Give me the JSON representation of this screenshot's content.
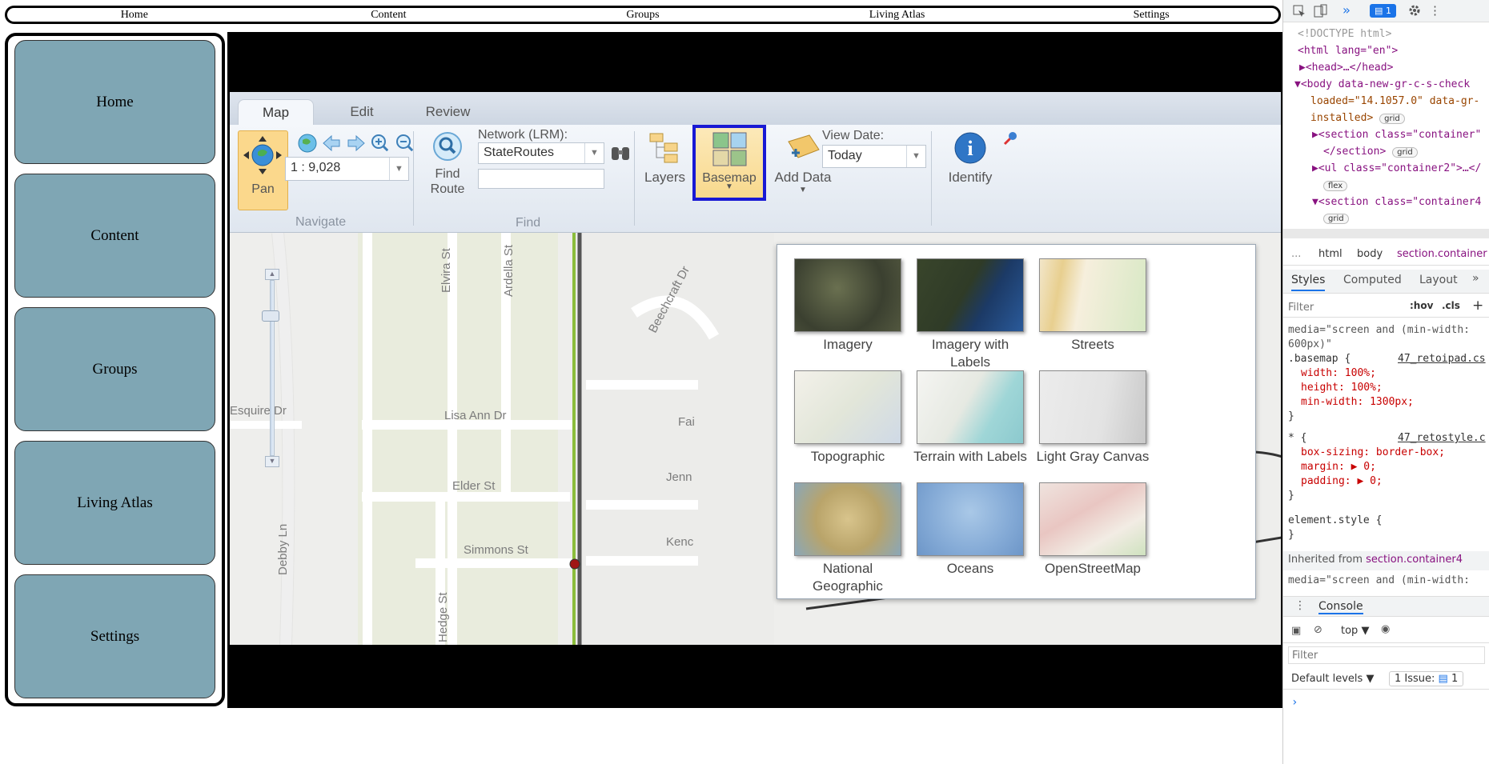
{
  "topnav": {
    "items": [
      "Home",
      "Content",
      "Groups",
      "Living Atlas",
      "Settings"
    ]
  },
  "sidebar": {
    "items": [
      "Home",
      "Content",
      "Groups",
      "Living Atlas",
      "Settings"
    ]
  },
  "app": {
    "tabs": [
      "Map",
      "Edit",
      "Review"
    ],
    "pan_label": "Pan",
    "scale_value": "1 : 9,028",
    "navigate_label": "Navigate",
    "find_route_label": "Find\nRoute",
    "network_label": "Network (LRM):",
    "network_value": "StateRoutes",
    "find_label": "Find",
    "layers_label": "Layers",
    "basemap_label": "Basemap",
    "add_data_label": "Add Data",
    "view_date_label": "View Date:",
    "view_date_value": "Today",
    "identify_label": "Identify",
    "streets": [
      "Elvira St",
      "Ardella St",
      "Lisa Ann Dr",
      "Elder St",
      "Simmons St",
      "Hedge St",
      "Debby Ln",
      "Esquire Dr",
      "Beechcraft Dr",
      "Fai",
      "Jenn",
      "Kenc"
    ],
    "basemaps": [
      "Imagery",
      "Imagery with Labels",
      "Streets",
      "Topographic",
      "Terrain with Labels",
      "Light Gray Canvas",
      "National Geographic",
      "Oceans",
      "OpenStreetMap"
    ]
  },
  "devtools": {
    "issues_count": "1",
    "html_lines": [
      "<!DOCTYPE html>",
      "<html lang=\"en\">",
      "<head>…</head>",
      "<body data-new-gr-c-s-check",
      "loaded=\"14.1057.0\" data-gr-",
      "installed>",
      "<section class=\"container\"",
      "</section>",
      "<ul class=\"container2\">…</",
      "<section class=\"container4"
    ],
    "badges": [
      "grid",
      "grid",
      "flex",
      "grid"
    ],
    "breadcrumb": [
      "...",
      "html",
      "body",
      "section.container"
    ],
    "panel_tabs": [
      "Styles",
      "Computed",
      "Layout"
    ],
    "filter_placeholder": "Filter",
    "hov": ":hov",
    "cls": ".cls",
    "css_lines": [
      "media=\"screen and (min-width:",
      "600px)\"",
      ".basemap {",
      "47_retoipad.cs",
      "width: 100%;",
      "height: 100%;",
      "min-width: 1300px;",
      "}",
      "* {",
      "47_retostyle.c",
      "box-sizing: border-box;",
      "margin: ▶ 0;",
      "padding: ▶ 0;",
      "}",
      "element.style {",
      "}",
      "Inherited from",
      "section.container4",
      "media=\"screen and (min-width:"
    ],
    "console_tab": "Console",
    "context": "top",
    "console_filter": "Filter",
    "levels": "Default levels",
    "issue_text": "1 Issue:",
    "issue_badge": "1"
  }
}
